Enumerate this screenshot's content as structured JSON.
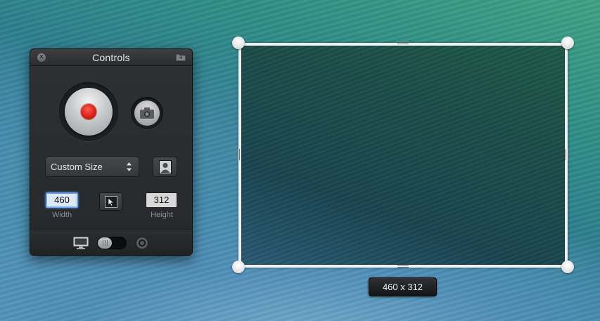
{
  "controls_panel": {
    "title": "Controls",
    "size_preset": "Custom Size",
    "width": {
      "value": "460",
      "label": "Width"
    },
    "height": {
      "value": "312",
      "label": "Height"
    }
  },
  "capture_region": {
    "size_badge": "460 x 312"
  },
  "icons": {
    "close": "close-icon",
    "folder": "folder-icon",
    "record": "record-icon",
    "camera": "camera-icon",
    "portrait": "portrait-icon",
    "cursor": "cursor-icon",
    "display": "display-icon",
    "webcam": "webcam-icon"
  },
  "colors": {
    "record_red": "#d81d12",
    "focus_blue": "#6aa7ea",
    "panel_bg": "#2a2c2f",
    "frame_border": "#eef0f1"
  }
}
